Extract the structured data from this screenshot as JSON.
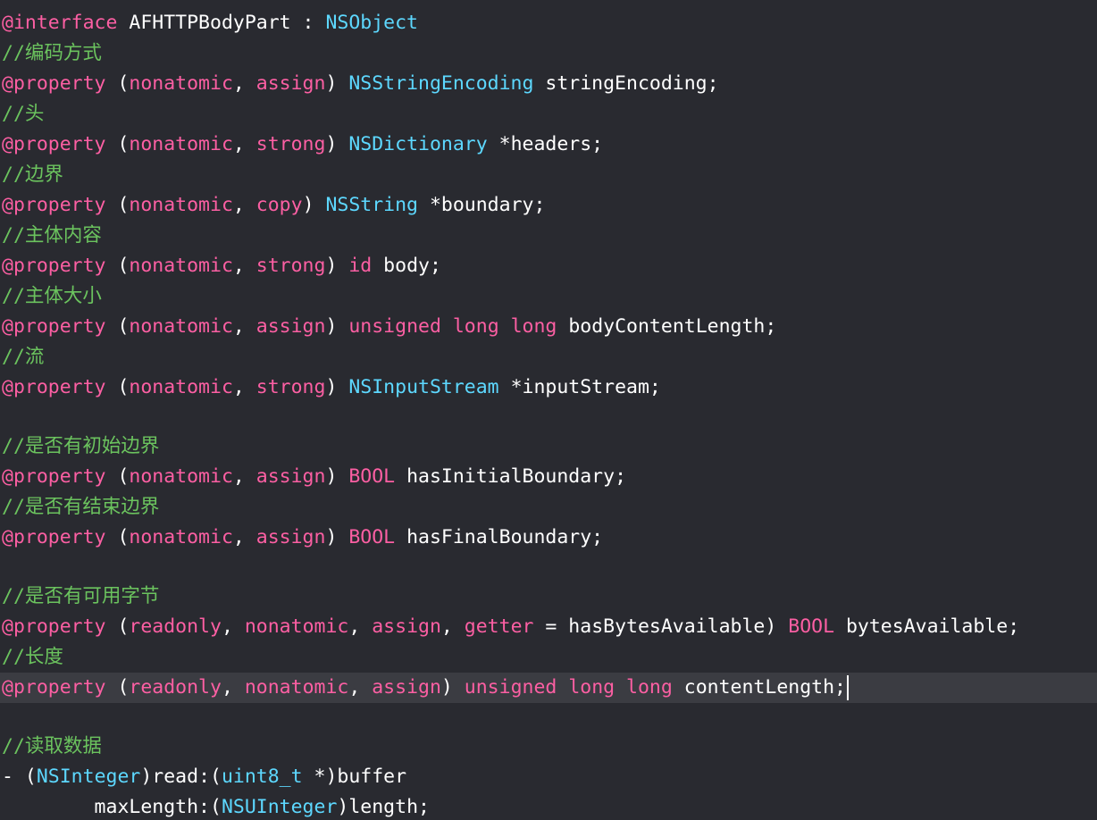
{
  "editor": {
    "theme": {
      "background": "#292a30",
      "current_line": "#3b3c42",
      "keyword": "#fc5fa3",
      "class": "#5dd8ff",
      "comment": "#6bc35e",
      "plain": "#ffffff"
    },
    "current_line_index": 22,
    "lines": [
      [
        {
          "t": "@interface",
          "c": "kw"
        },
        {
          "t": " AFHTTPBodyPart : ",
          "c": "plain"
        },
        {
          "t": "NSObject",
          "c": "cls"
        }
      ],
      [
        {
          "t": "//编码方式",
          "c": "cmt"
        }
      ],
      [
        {
          "t": "@property",
          "c": "kw"
        },
        {
          "t": " (",
          "c": "plain"
        },
        {
          "t": "nonatomic",
          "c": "kw"
        },
        {
          "t": ", ",
          "c": "plain"
        },
        {
          "t": "assign",
          "c": "kw"
        },
        {
          "t": ") ",
          "c": "plain"
        },
        {
          "t": "NSStringEncoding",
          "c": "cls"
        },
        {
          "t": " stringEncoding;",
          "c": "plain"
        }
      ],
      [
        {
          "t": "//头",
          "c": "cmt"
        }
      ],
      [
        {
          "t": "@property",
          "c": "kw"
        },
        {
          "t": " (",
          "c": "plain"
        },
        {
          "t": "nonatomic",
          "c": "kw"
        },
        {
          "t": ", ",
          "c": "plain"
        },
        {
          "t": "strong",
          "c": "kw"
        },
        {
          "t": ") ",
          "c": "plain"
        },
        {
          "t": "NSDictionary",
          "c": "cls"
        },
        {
          "t": " *headers;",
          "c": "plain"
        }
      ],
      [
        {
          "t": "//边界",
          "c": "cmt"
        }
      ],
      [
        {
          "t": "@property",
          "c": "kw"
        },
        {
          "t": " (",
          "c": "plain"
        },
        {
          "t": "nonatomic",
          "c": "kw"
        },
        {
          "t": ", ",
          "c": "plain"
        },
        {
          "t": "copy",
          "c": "kw"
        },
        {
          "t": ") ",
          "c": "plain"
        },
        {
          "t": "NSString",
          "c": "cls"
        },
        {
          "t": " *boundary;",
          "c": "plain"
        }
      ],
      [
        {
          "t": "//主体内容",
          "c": "cmt"
        }
      ],
      [
        {
          "t": "@property",
          "c": "kw"
        },
        {
          "t": " (",
          "c": "plain"
        },
        {
          "t": "nonatomic",
          "c": "kw"
        },
        {
          "t": ", ",
          "c": "plain"
        },
        {
          "t": "strong",
          "c": "kw"
        },
        {
          "t": ") ",
          "c": "plain"
        },
        {
          "t": "id",
          "c": "kw"
        },
        {
          "t": " body;",
          "c": "plain"
        }
      ],
      [
        {
          "t": "//主体大小",
          "c": "cmt"
        }
      ],
      [
        {
          "t": "@property",
          "c": "kw"
        },
        {
          "t": " (",
          "c": "plain"
        },
        {
          "t": "nonatomic",
          "c": "kw"
        },
        {
          "t": ", ",
          "c": "plain"
        },
        {
          "t": "assign",
          "c": "kw"
        },
        {
          "t": ") ",
          "c": "plain"
        },
        {
          "t": "unsigned",
          "c": "kw"
        },
        {
          "t": " ",
          "c": "plain"
        },
        {
          "t": "long",
          "c": "kw"
        },
        {
          "t": " ",
          "c": "plain"
        },
        {
          "t": "long",
          "c": "kw"
        },
        {
          "t": " bodyContentLength;",
          "c": "plain"
        }
      ],
      [
        {
          "t": "//流",
          "c": "cmt"
        }
      ],
      [
        {
          "t": "@property",
          "c": "kw"
        },
        {
          "t": " (",
          "c": "plain"
        },
        {
          "t": "nonatomic",
          "c": "kw"
        },
        {
          "t": ", ",
          "c": "plain"
        },
        {
          "t": "strong",
          "c": "kw"
        },
        {
          "t": ") ",
          "c": "plain"
        },
        {
          "t": "NSInputStream",
          "c": "cls"
        },
        {
          "t": " *inputStream;",
          "c": "plain"
        }
      ],
      [],
      [
        {
          "t": "//是否有初始边界",
          "c": "cmt"
        }
      ],
      [
        {
          "t": "@property",
          "c": "kw"
        },
        {
          "t": " (",
          "c": "plain"
        },
        {
          "t": "nonatomic",
          "c": "kw"
        },
        {
          "t": ", ",
          "c": "plain"
        },
        {
          "t": "assign",
          "c": "kw"
        },
        {
          "t": ") ",
          "c": "plain"
        },
        {
          "t": "BOOL",
          "c": "kw"
        },
        {
          "t": " hasInitialBoundary;",
          "c": "plain"
        }
      ],
      [
        {
          "t": "//是否有结束边界",
          "c": "cmt"
        }
      ],
      [
        {
          "t": "@property",
          "c": "kw"
        },
        {
          "t": " (",
          "c": "plain"
        },
        {
          "t": "nonatomic",
          "c": "kw"
        },
        {
          "t": ", ",
          "c": "plain"
        },
        {
          "t": "assign",
          "c": "kw"
        },
        {
          "t": ") ",
          "c": "plain"
        },
        {
          "t": "BOOL",
          "c": "kw"
        },
        {
          "t": " hasFinalBoundary;",
          "c": "plain"
        }
      ],
      [],
      [
        {
          "t": "//是否有可用字节",
          "c": "cmt"
        }
      ],
      [
        {
          "t": "@property",
          "c": "kw"
        },
        {
          "t": " (",
          "c": "plain"
        },
        {
          "t": "readonly",
          "c": "kw"
        },
        {
          "t": ", ",
          "c": "plain"
        },
        {
          "t": "nonatomic",
          "c": "kw"
        },
        {
          "t": ", ",
          "c": "plain"
        },
        {
          "t": "assign",
          "c": "kw"
        },
        {
          "t": ", ",
          "c": "plain"
        },
        {
          "t": "getter",
          "c": "kw"
        },
        {
          "t": " = hasBytesAvailable) ",
          "c": "plain"
        },
        {
          "t": "BOOL",
          "c": "kw"
        },
        {
          "t": " bytesAvailable;",
          "c": "plain"
        }
      ],
      [
        {
          "t": "//长度",
          "c": "cmt"
        }
      ],
      [
        {
          "t": "@property",
          "c": "kw"
        },
        {
          "t": " (",
          "c": "plain"
        },
        {
          "t": "readonly",
          "c": "kw"
        },
        {
          "t": ", ",
          "c": "plain"
        },
        {
          "t": "nonatomic",
          "c": "kw"
        },
        {
          "t": ", ",
          "c": "plain"
        },
        {
          "t": "assign",
          "c": "kw"
        },
        {
          "t": ") ",
          "c": "plain"
        },
        {
          "t": "unsigned",
          "c": "kw"
        },
        {
          "t": " ",
          "c": "plain"
        },
        {
          "t": "long",
          "c": "kw"
        },
        {
          "t": " ",
          "c": "plain"
        },
        {
          "t": "long",
          "c": "kw"
        },
        {
          "t": " contentLength;",
          "c": "plain"
        }
      ],
      [],
      [
        {
          "t": "//读取数据",
          "c": "cmt"
        }
      ],
      [
        {
          "t": "- (",
          "c": "plain"
        },
        {
          "t": "NSInteger",
          "c": "cls"
        },
        {
          "t": ")read:(",
          "c": "plain"
        },
        {
          "t": "uint8_t",
          "c": "cls"
        },
        {
          "t": " *)buffer",
          "c": "plain"
        }
      ],
      [
        {
          "t": "        maxLength:(",
          "c": "plain"
        },
        {
          "t": "NSUInteger",
          "c": "cls"
        },
        {
          "t": ")length;",
          "c": "plain"
        }
      ]
    ]
  }
}
